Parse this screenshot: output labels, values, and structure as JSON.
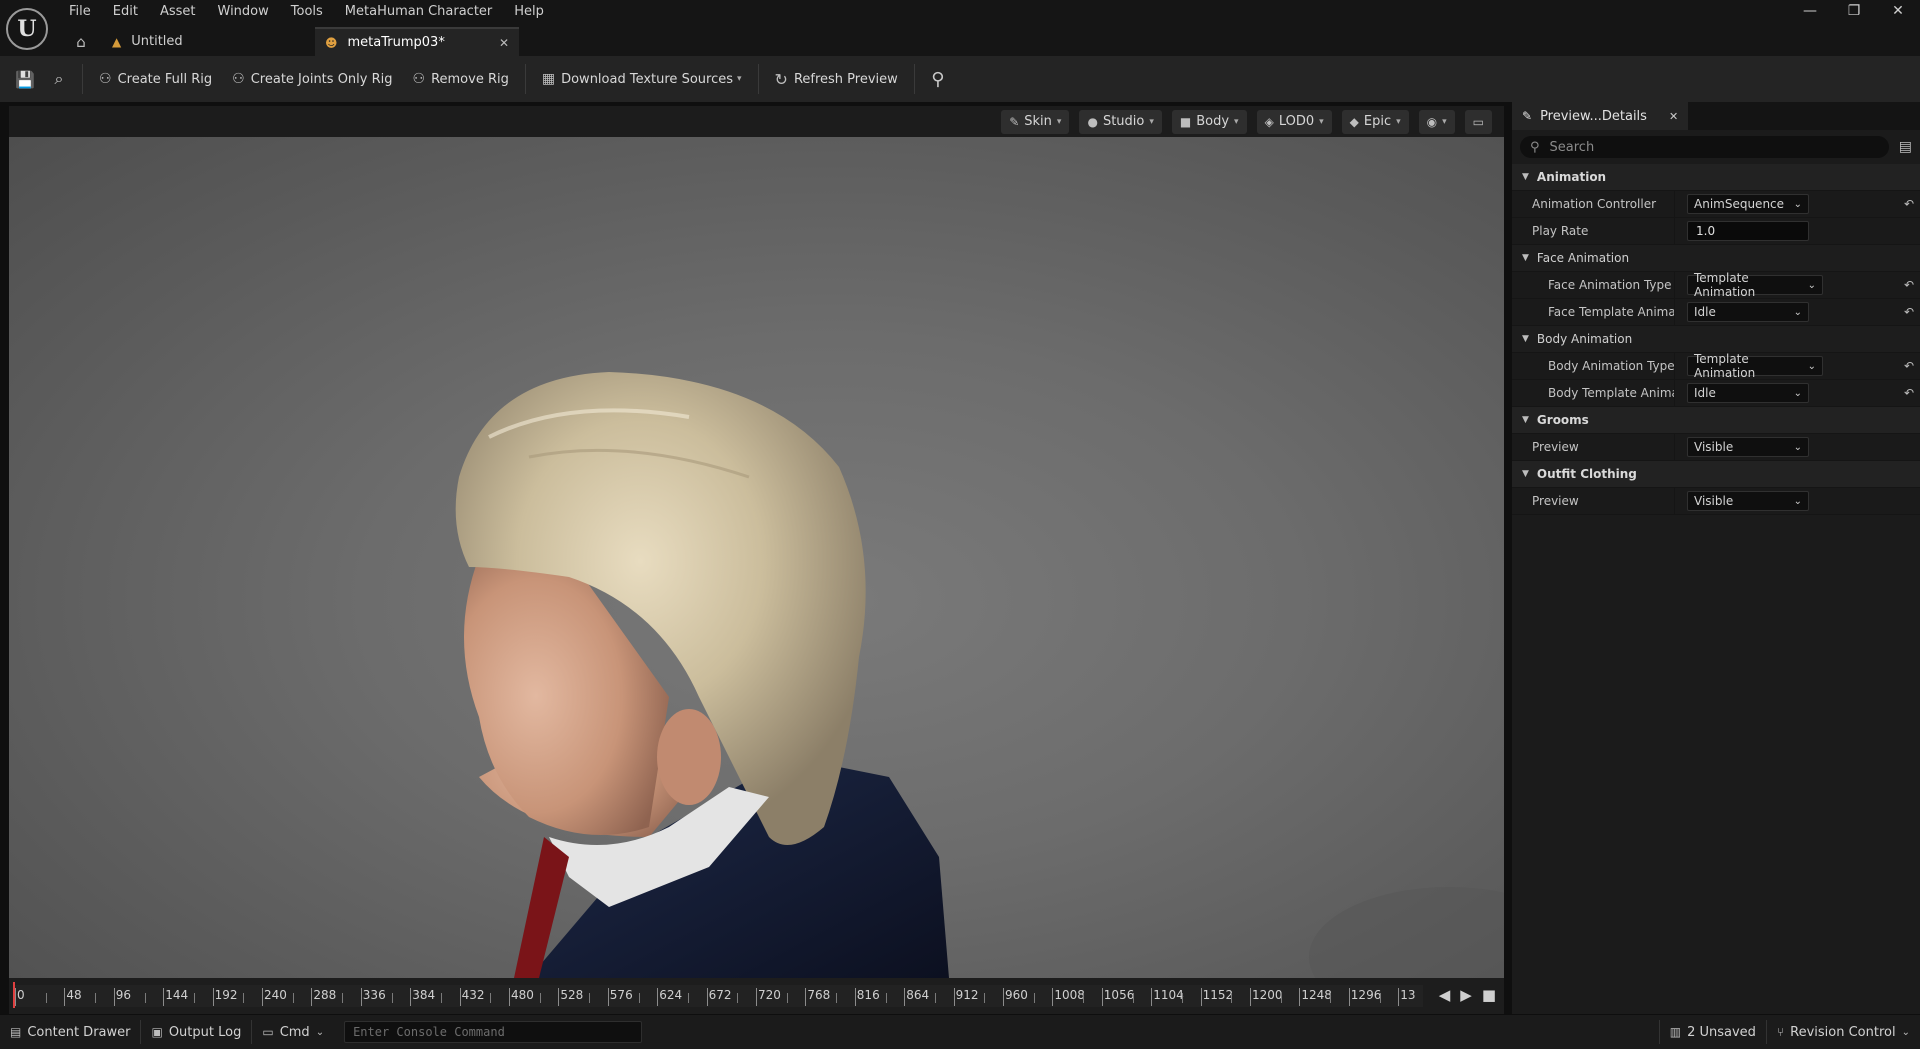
{
  "menu": [
    "File",
    "Edit",
    "Asset",
    "Window",
    "Tools",
    "MetaHuman Character",
    "Help"
  ],
  "window_controls": {
    "minimize": "—",
    "restore": "❐",
    "close": "✕"
  },
  "tabs": {
    "untitled": "Untitled",
    "active": "metaTrump03*"
  },
  "toolbar": {
    "create_full_rig": "Create Full Rig",
    "create_joints_only_rig": "Create Joints Only Rig",
    "remove_rig": "Remove Rig",
    "download_texture_sources": "Download Texture Sources",
    "refresh_preview": "Refresh Preview"
  },
  "viewport_bar": {
    "skin": "Skin",
    "studio": "Studio",
    "body": "Body",
    "lod": "LOD0",
    "quality": "Epic"
  },
  "timeline": {
    "ticks": [
      "0",
      "48",
      "96",
      "144",
      "192",
      "240",
      "288",
      "336",
      "384",
      "432",
      "480",
      "528",
      "576",
      "624",
      "672",
      "720",
      "768",
      "816",
      "864",
      "912",
      "960",
      "1008",
      "1056",
      "1104",
      "1152",
      "1200",
      "1248",
      "1296",
      "13"
    ]
  },
  "details": {
    "tab_title": "Preview...Details",
    "search_placeholder": "Search",
    "animation": {
      "section": "Animation",
      "controller_label": "Animation Controller",
      "controller_value": "AnimSequence",
      "play_rate_label": "Play Rate",
      "play_rate_value": "1.0"
    },
    "face_animation": {
      "section": "Face Animation",
      "type_label": "Face Animation Type",
      "type_value": "Template Animation",
      "template_label": "Face Template Anima...",
      "template_value": "Idle"
    },
    "body_animation": {
      "section": "Body Animation",
      "type_label": "Body Animation Type",
      "type_value": "Template Animation",
      "template_label": "Body Template Anima...",
      "template_value": "Idle"
    },
    "grooms": {
      "section": "Grooms",
      "preview_label": "Preview",
      "preview_value": "Visible"
    },
    "outfit_clothing": {
      "section": "Outfit Clothing",
      "preview_label": "Preview",
      "preview_value": "Visible"
    }
  },
  "statusbar": {
    "content_drawer": "Content Drawer",
    "output_log": "Output Log",
    "cmd": "Cmd",
    "console_placeholder": "Enter Console Command",
    "unsaved": "2 Unsaved",
    "revision_control": "Revision Control"
  }
}
